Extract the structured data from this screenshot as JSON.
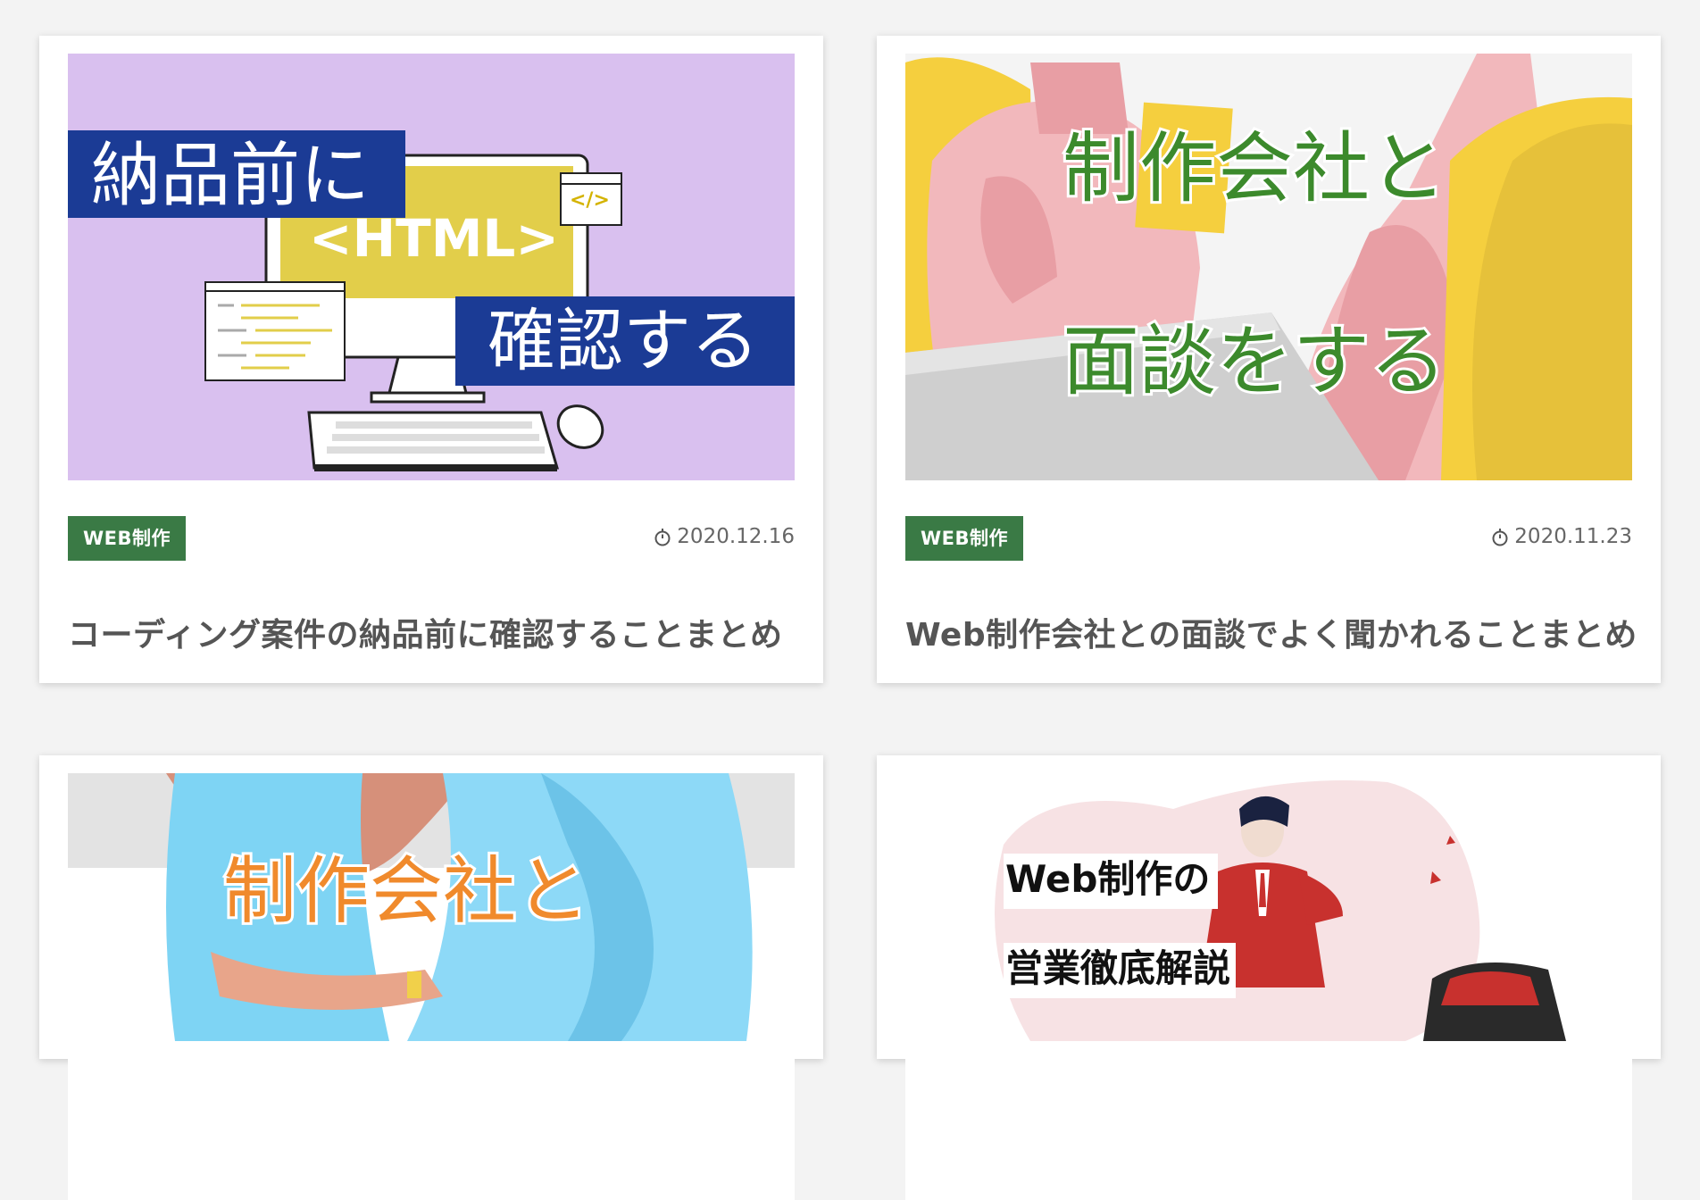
{
  "posts": [
    {
      "category": "WEB制作",
      "date": "2020.12.16",
      "title": "コーディング案件の納品前に確認することまとめ",
      "thumb": {
        "line1": "納品前に",
        "line2": "確認する",
        "screen_text": "<HTML>",
        "code_text": "</>"
      },
      "colors": {
        "bg": "#d9c0ef",
        "banner": "#1b3b95",
        "screen": "#e2ce4a"
      }
    },
    {
      "category": "WEB制作",
      "date": "2020.11.23",
      "title": "Web制作会社との面談でよく聞かれることまとめ",
      "thumb": {
        "line1": "制作会社と",
        "line2": "面談をする"
      },
      "colors": {
        "bg": "#f4f4f4",
        "text": "#3c8a2c",
        "pink": "#f2b8bc",
        "yellow": "#f5cf3e"
      }
    },
    {
      "thumb": {
        "line1": "制作会社と"
      },
      "colors": {
        "text": "#f08a2c",
        "blue": "#7ed4f4"
      }
    },
    {
      "thumb": {
        "line1": "Web制作の",
        "line2": "営業徹底解説"
      },
      "colors": {
        "blob": "#f7e2e4",
        "suit": "#c8312e"
      }
    }
  ],
  "icons": {
    "date": "stopwatch-icon"
  },
  "colors": {
    "tag_bg": "#3a7a45",
    "page_bg": "#f3f3f3"
  }
}
